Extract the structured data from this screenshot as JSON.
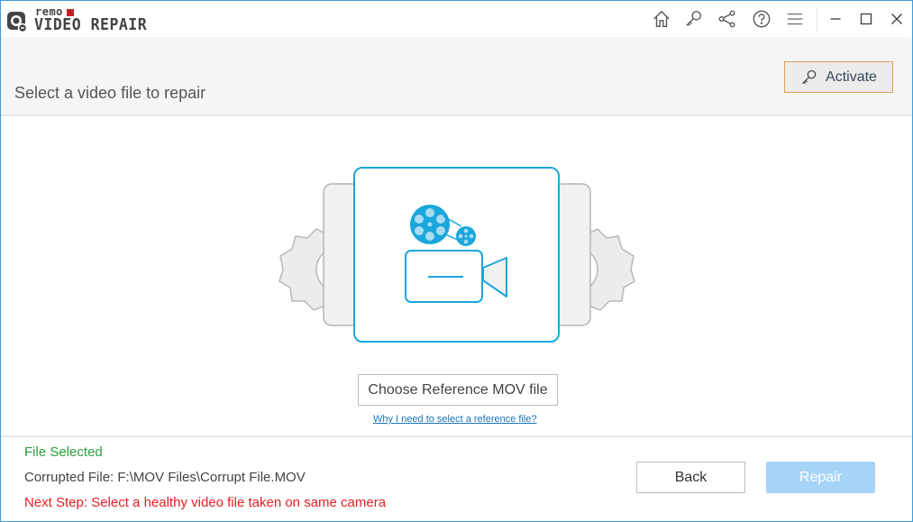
{
  "app": {
    "brand_small": "remo",
    "brand_title": "VIDEO REPAIR",
    "accent_color": "#1aa7dc",
    "border_color": "#3c9de0"
  },
  "titlebar": {
    "icons": [
      {
        "name": "home-icon",
        "label": "Home"
      },
      {
        "name": "key-icon",
        "label": "Activate"
      },
      {
        "name": "share-icon",
        "label": "Share"
      },
      {
        "name": "help-icon",
        "label": "Help"
      },
      {
        "name": "menu-icon",
        "label": "Menu"
      }
    ],
    "window_controls": [
      "minimize",
      "maximize",
      "close"
    ]
  },
  "header": {
    "title": "Select a video file to repair",
    "activate_label": "Activate"
  },
  "main": {
    "choose_button_label": "Choose Reference MOV file",
    "help_link": "Why I need to select a reference file?"
  },
  "footer": {
    "status": "File Selected",
    "status_color": "#2a9d3b",
    "corrupted_file": "Corrupted File: F:\\MOV Files\\Corrupt File.MOV",
    "next_step": "Next Step: Select a healthy video file taken on same camera",
    "next_step_color": "#e41e26",
    "back_label": "Back",
    "repair_label": "Repair",
    "repair_enabled": false
  }
}
